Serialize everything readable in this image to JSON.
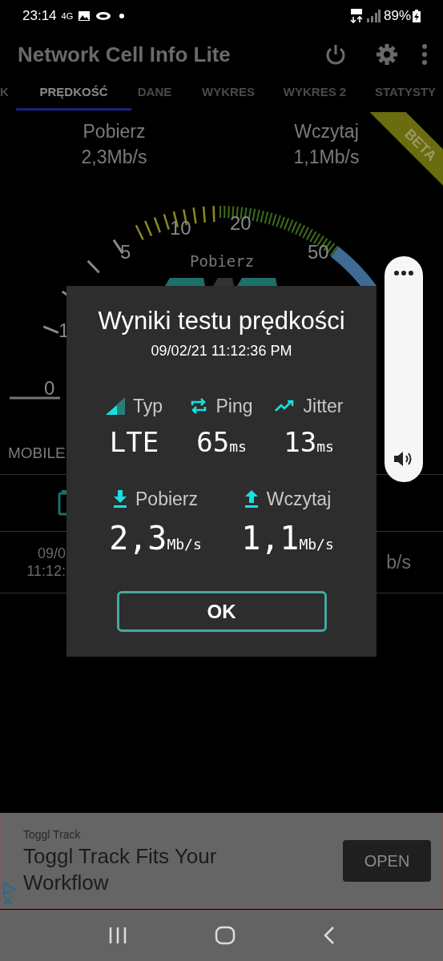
{
  "status_bar": {
    "time": "23:14",
    "network": "4G",
    "battery": "89%"
  },
  "app_bar": {
    "title": "Network Cell Info Lite"
  },
  "tabs": [
    {
      "label": "K",
      "selected": false
    },
    {
      "label": "PRĘDKOŚĆ",
      "selected": true
    },
    {
      "label": "DANE",
      "selected": false
    },
    {
      "label": "WYKRES",
      "selected": false
    },
    {
      "label": "WYKRES 2",
      "selected": false
    },
    {
      "label": "STATYSTY",
      "selected": false
    }
  ],
  "speeds": [
    {
      "label": "Pobierz",
      "value": "2,3Mb/s"
    },
    {
      "label": "Wczytaj",
      "value": "1,1Mb/s"
    }
  ],
  "beta_ribbon": "BETA",
  "gauge": {
    "caption": "Pobierz",
    "scale_labels": [
      "0",
      "1",
      "5",
      "10",
      "20",
      "50"
    ]
  },
  "connection_label": "MOBILE",
  "history": {
    "date": "09/0",
    "time": "11:12:",
    "speed": "b/s"
  },
  "dialog": {
    "title": "Wyniki testu prędkości",
    "timestamp": "09/02/21 11:12:36 PM",
    "stats": [
      {
        "kind": "type",
        "label": "Typ",
        "value": "LTE"
      },
      {
        "kind": "ping",
        "label": "Ping",
        "value": "65",
        "unit": "ms"
      },
      {
        "kind": "jitter",
        "label": "Jitter",
        "value": "13",
        "unit": "ms"
      }
    ],
    "transfers": [
      {
        "kind": "download",
        "label": "Pobierz",
        "value": "2,3",
        "unit": "Mb/s"
      },
      {
        "kind": "upload",
        "label": "Wczytaj",
        "value": "1,1",
        "unit": "Mb/s"
      }
    ],
    "button": "OK"
  },
  "ad": {
    "advertiser": "Toggl Track",
    "headline": "Toggl Track Fits Your Workflow",
    "button": "OPEN"
  }
}
